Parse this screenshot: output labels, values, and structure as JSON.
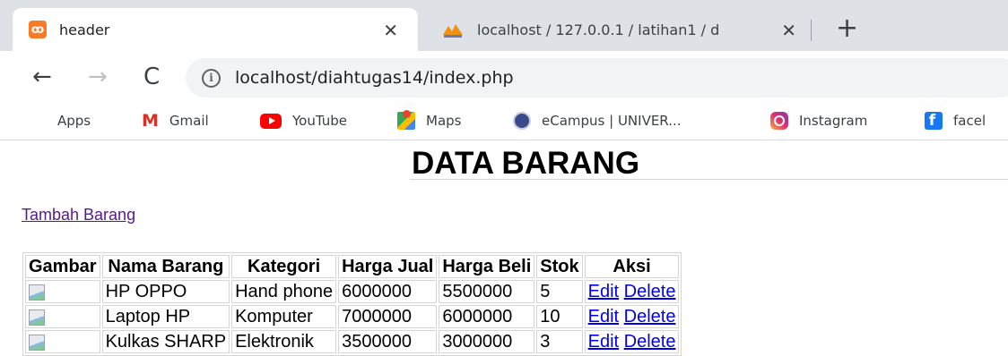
{
  "browser": {
    "tabs": [
      {
        "title": "header",
        "active": true,
        "icon": "xampp-icon"
      },
      {
        "title": "localhost / 127.0.0.1 / latihan1 / d",
        "active": false,
        "icon": "phpmyadmin-icon"
      }
    ],
    "close_glyph": "✕",
    "new_tab_glyph": "+",
    "nav": {
      "back": "←",
      "forward": "→",
      "reload": "C"
    },
    "url": "localhost/diahtugas14/index.php",
    "bookmarks": [
      {
        "label": "Apps",
        "icon": "apps-grid-icon"
      },
      {
        "label": "Gmail",
        "icon": "gmail-icon"
      },
      {
        "label": "YouTube",
        "icon": "youtube-icon"
      },
      {
        "label": "Maps",
        "icon": "maps-icon"
      },
      {
        "label": "eCampus | UNIVER...",
        "icon": "ecampus-icon"
      },
      {
        "label": "Instagram",
        "icon": "instagram-icon"
      },
      {
        "label": "facel",
        "icon": "facebook-icon"
      }
    ]
  },
  "page": {
    "title": "DATA BARANG",
    "add_link": "Tambah Barang",
    "table": {
      "headers": [
        "Gambar",
        "Nama Barang",
        "Kategori",
        "Harga Jual",
        "Harga Beli",
        "Stok",
        "Aksi"
      ],
      "rows": [
        {
          "nama": "HP OPPO",
          "kategori": "Hand phone",
          "harga_jual": "6000000",
          "harga_beli": "5500000",
          "stok": "5",
          "edit": "Edit",
          "delete": "Delete"
        },
        {
          "nama": "Laptop HP",
          "kategori": "Komputer",
          "harga_jual": "7000000",
          "harga_beli": "6000000",
          "stok": "10",
          "edit": "Edit",
          "delete": "Delete"
        },
        {
          "nama": "Kulkas SHARP",
          "kategori": "Elektronik",
          "harga_jual": "3500000",
          "harga_beli": "3000000",
          "stok": "3",
          "edit": "Edit",
          "delete": "Delete"
        }
      ]
    }
  },
  "colors": {
    "link_visited": "#551a8b",
    "link": "#0000ee",
    "tabstrip": "#dee1e6",
    "omnibox": "#f1f3f4"
  }
}
